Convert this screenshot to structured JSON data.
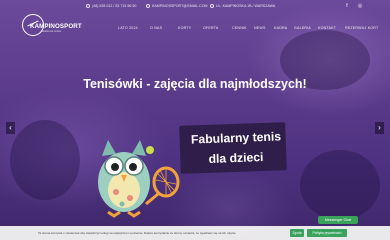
{
  "topbar": {
    "phone": "(48) 535 012 / 53 715 96 50",
    "email": "KAMPINOSSPORT@GMAIL.COM",
    "address": "UL. KAMPINOSKA 1B / WARSZAWA"
  },
  "logo": {
    "text": "KAMPINOSPORT",
    "subtitle": "akademia tenisa"
  },
  "nav": [
    "LATO 2024",
    "O NAS",
    "KORTY",
    "OFERTA",
    "CENNIK",
    "NEWS",
    "KADRA",
    "GALERIA",
    "KONTAKT",
    "REZERWUJ KORT"
  ],
  "hero": {
    "title": "Tenisówki - zajęcia dla najmłodszych!",
    "badge_line1": "Fabularny tenis",
    "badge_line2": "dla dzieci",
    "prev": "‹",
    "next": "›"
  },
  "chat": {
    "label": "Messenger Chat"
  },
  "cookie": {
    "text": "Ta strona korzysta z ciasteczek aby świadczyć usługi na najwyższym poziomie. Dalsze korzystanie ze strony oznacza, że zgadzasz się na ich użycie.",
    "ok_label": "Zgoda",
    "policy_label": "Polityka prywatności"
  },
  "colors": {
    "brand_purple": "#5a3a8a",
    "accent_green": "#3aa35b",
    "badge_bg": "#2f1d4a"
  }
}
